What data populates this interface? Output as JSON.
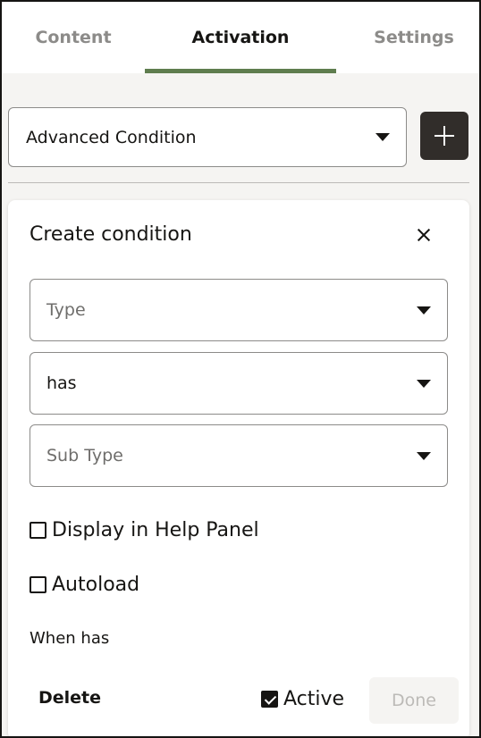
{
  "tabs": [
    {
      "label": "Content",
      "active": false
    },
    {
      "label": "Activation",
      "active": true
    },
    {
      "label": "Settings",
      "active": false
    }
  ],
  "condition_select": {
    "value": "Advanced Condition"
  },
  "add_button": {
    "label": "+"
  },
  "panel": {
    "title": "Create condition",
    "close_icon": "close-icon",
    "type_field": {
      "placeholder": "Type"
    },
    "operator_field": {
      "value": "has"
    },
    "subtype_field": {
      "placeholder": "Sub Type"
    },
    "display_in_help": {
      "label": "Display in Help Panel",
      "checked": false
    },
    "autoload": {
      "label": "Autoload",
      "checked": false
    },
    "summary": "When has",
    "delete_label": "Delete",
    "active": {
      "label": "Active",
      "checked": true
    },
    "done_label": "Done"
  },
  "colors": {
    "tab_indicator": "#5f7d4f",
    "add_button_bg": "#312d2a",
    "panel_bg": "#f5f4f2"
  }
}
